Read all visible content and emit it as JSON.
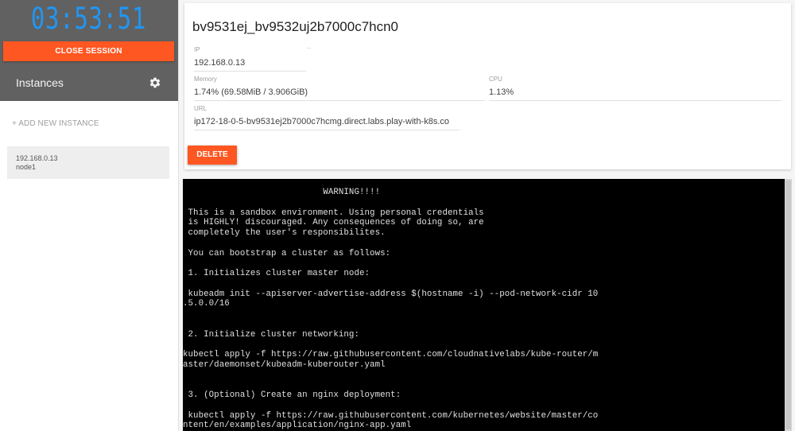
{
  "sidebar": {
    "timer": "03:53:51",
    "close_session_label": "CLOSE SESSION",
    "instances_label": "Instances",
    "settings_icon": "gear-icon",
    "add_instance_label": "+ ADD NEW INSTANCE",
    "instances": [
      {
        "ip": "192.168.0.13",
        "name": "node1"
      }
    ]
  },
  "instance": {
    "title": "bv9531ej_bv9532uj2b7000c7hcn0",
    "ip": {
      "label": "IP",
      "value": "192.168.0.13"
    },
    "memory": {
      "label": "Memory",
      "value": "1.74% (69.58MiB / 3.906GiB)"
    },
    "cpu": {
      "label": "CPU",
      "value": "1.13%"
    },
    "url": {
      "label": "URL",
      "value": "ip172-18-0-5-bv9531ej2b7000c7hcmg.direct.labs.play-with-k8s.co"
    },
    "delete_label": "DELETE"
  },
  "terminal": {
    "lines": [
      "                           WARNING!!!!",
      "",
      " This is a sandbox environment. Using personal credentials",
      " is HIGHLY! discouraged. Any consequences of doing so, are",
      " completely the user's responsibilites.",
      "",
      " You can bootstrap a cluster as follows:",
      "",
      " 1. Initializes cluster master node:",
      "",
      " kubeadm init --apiserver-advertise-address $(hostname -i) --pod-network-cidr 10",
      ".5.0.0/16",
      "",
      "",
      " 2. Initialize cluster networking:",
      "",
      "kubectl apply -f https://raw.githubusercontent.com/cloudnativelabs/kube-router/m",
      "aster/daemonset/kubeadm-kuberouter.yaml",
      "",
      "",
      " 3. (Optional) Create an nginx deployment:",
      "",
      " kubectl apply -f https://raw.githubusercontent.com/kubernetes/website/master/co",
      "ntent/en/examples/application/nginx-app.yaml"
    ]
  },
  "colors": {
    "accent": "#ff5722",
    "timer": "#2196f3",
    "sidebar_header": "#616161",
    "terminal_bg": "#000000"
  }
}
